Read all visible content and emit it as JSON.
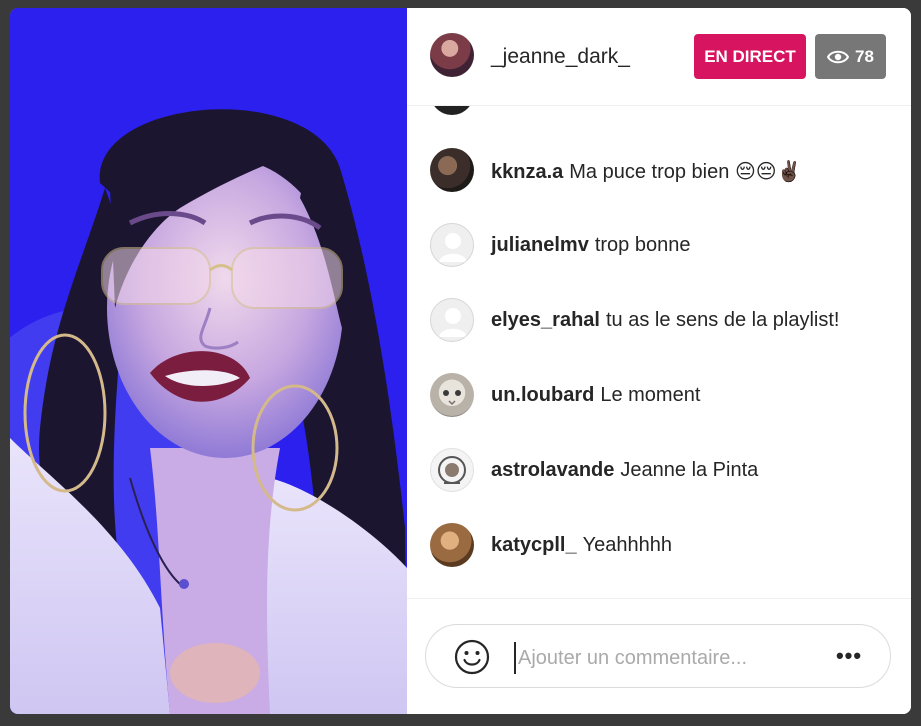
{
  "stream": {
    "host_username": "_jeanne_dark_",
    "live_label": "EN DIRECT",
    "viewer_count": "78"
  },
  "comments": [
    {
      "user": "kknza.a",
      "text": "Ma puce trop bien",
      "emoji": "😔😔✌🏿",
      "avatar": "photo-dark"
    },
    {
      "user": "julianelmv",
      "text": "trop bonne",
      "emoji": "",
      "avatar": "default"
    },
    {
      "user": "elyes_rahal",
      "text": "tu as le sens de la playlist!",
      "emoji": "",
      "avatar": "default"
    },
    {
      "user": "un.loubard",
      "text": "Le moment",
      "emoji": "",
      "avatar": "photo-cat"
    },
    {
      "user": "astrolavande",
      "text": "Jeanne la Pinta",
      "emoji": "",
      "avatar": "photo-logo"
    },
    {
      "user": "katycpll_",
      "text": "Yeahhhhh",
      "emoji": "",
      "avatar": "photo-warm"
    }
  ],
  "composer": {
    "placeholder": "Ajouter un commentaire..."
  },
  "icons": {
    "viewers": "eye-icon",
    "emoji": "smiley-icon",
    "more": "more-options-icon"
  },
  "colors": {
    "live_badge": "#d6145f",
    "viewer_badge": "#777777",
    "video_background": "#2a1cf0"
  }
}
